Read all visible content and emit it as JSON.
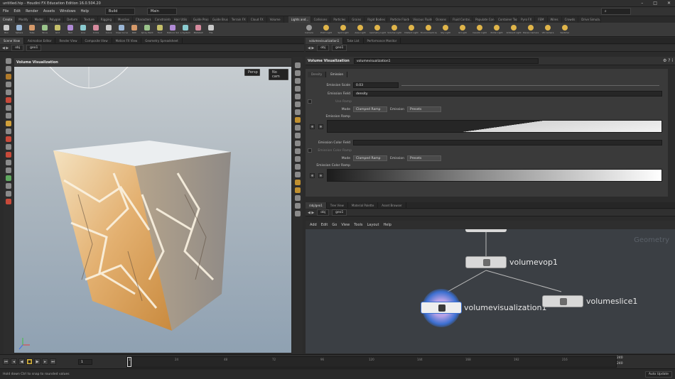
{
  "window": {
    "title": "untitled.hip - Houdini FX Education Edition 16.0.504.20",
    "controls": [
      "–",
      "□",
      "✕"
    ]
  },
  "menubar": {
    "items": [
      "File",
      "Edit",
      "Render",
      "Assets",
      "Windows",
      "Help"
    ],
    "build_dropdown": "Build",
    "main_dropdown": "Main"
  },
  "shelf_tabs": {
    "left": [
      "Create",
      "Modify",
      "Model",
      "Polygon",
      "Deform",
      "Texture",
      "Rigging",
      "Muscles",
      "Characters",
      "Constraints",
      "Hair Utils",
      "Guide Process",
      "Guide Brushes",
      "Terrain FX",
      "Cloud FX",
      "Volume"
    ],
    "right": [
      "Lights and...",
      "Collisions",
      "Particles",
      "Grains",
      "Rigid Bodies",
      "Particle Fluids",
      "Viscous Fluids",
      "Oceans",
      "Fluid Contai...",
      "Populate Con...",
      "Container Tools",
      "Pyro FX",
      "FEM",
      "Wires",
      "Crowds",
      "Drive Simula..."
    ]
  },
  "shelf_tools_left": [
    "Box",
    "Sphere",
    "Tube",
    "Torus",
    "Grid",
    "Null",
    "Line",
    "Circle",
    "Curve",
    "Draw Curve",
    "Path",
    "Spray Paint",
    "Font",
    "Platonic Solids",
    "L-System",
    "Metaball",
    "File"
  ],
  "shelf_tools_right": [
    "Camera",
    "Point Light",
    "Spot Light",
    "Area Light",
    "Geometry Light",
    "Volume Light",
    "Distant Light",
    "Environment Light",
    "Sky Light",
    "GI Light",
    "Caustic Light",
    "Portal Light",
    "Ambient Light",
    "Stereo Camera",
    "VR Camera",
    "Switcher"
  ],
  "left_pane": {
    "tabs": [
      "Scene View",
      "Animation Editor",
      "Render View",
      "Composite View",
      "Motion FX View",
      "Geometry Spreadsheet"
    ],
    "path": [
      "obj",
      "geo1"
    ],
    "viewport_title": "Volume Visualization",
    "persp_dropdown": "Persp",
    "cam_dropdown": "No cam"
  },
  "param_pane": {
    "tabs": [
      "volumevisualization1",
      "Take List",
      "Performance Monitor"
    ],
    "path": [
      "obj",
      "geo1"
    ],
    "node_type": "Volume Visualization",
    "node_name": "volumevisualization1",
    "section_tabs": [
      "Density",
      "Emission"
    ],
    "emission_scale_label": "Emission Scale",
    "emission_scale_value": "0.03",
    "emission_field_label": "Emission Field",
    "emission_field_value": "density",
    "use_ramp_label": "Use Ramp",
    "mode_label": "Mode",
    "mode_value": "Clamped Ramp",
    "emission_label": "Emission",
    "emission_value": "Presets",
    "emission_ramp_label": "Emission Ramp",
    "emission_color_field_label": "Emission Color Field",
    "emission_color_ramp_toggle": "Emission Color Ramp",
    "color_mode_label": "Mode",
    "color_mode_value": "Clamped Ramp",
    "color_emission_label": "Emission",
    "color_emission_value": "Presets",
    "emission_color_ramp_label": "Emission Color Ramp"
  },
  "network_pane": {
    "tabs": [
      "/obj/geo1",
      "Tree View",
      "Material Palette",
      "Asset Browser"
    ],
    "path": [
      "obj",
      "geo1"
    ],
    "menu": [
      "Add",
      "Edit",
      "Go",
      "View",
      "Tools",
      "Layout",
      "Help"
    ],
    "context_label": "Geometry",
    "nodes": [
      {
        "name": "volumevop1"
      },
      {
        "name": "volumevisualization1"
      },
      {
        "name": "volumeslice1"
      }
    ]
  },
  "timeline": {
    "current_frame": "1",
    "start_frame": "1",
    "ticks": [
      "24",
      "48",
      "72",
      "96",
      "120",
      "144",
      "168",
      "192",
      "216"
    ],
    "end_frame_top": "240",
    "end_frame_bottom": "240"
  },
  "status": {
    "message": "Hold down Ctrl to snap to rounded values",
    "update_mode": "Auto Update"
  },
  "colors": {
    "accent_yellow": "#d6b23a",
    "node_selected_blue": "#3b6fd0",
    "viewport_top": "#c6ccd0",
    "viewport_bottom": "#8fa1b2"
  }
}
